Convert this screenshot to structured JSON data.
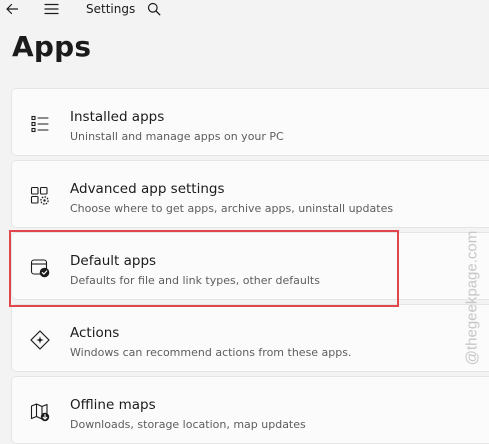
{
  "window": {
    "title": "Settings"
  },
  "page": {
    "title": "Apps"
  },
  "items": [
    {
      "title": "Installed apps",
      "description": "Uninstall and manage apps on your PC",
      "icon": "list-icon"
    },
    {
      "title": "Advanced app settings",
      "description": "Choose where to get apps, archive apps, uninstall updates",
      "icon": "app-settings-icon"
    },
    {
      "title": "Default apps",
      "description": "Defaults for file and link types, other defaults",
      "icon": "default-apps-icon"
    },
    {
      "title": "Actions",
      "description": "Windows can recommend actions from these apps.",
      "icon": "actions-icon"
    },
    {
      "title": "Offline maps",
      "description": "Downloads, storage location, map updates",
      "icon": "map-icon"
    }
  ],
  "watermark": {
    "text": "@thegeekpage.com"
  },
  "colors": {
    "background": "#f3f3f3",
    "card": "#fbfbfb",
    "highlight": "#e0464b"
  }
}
